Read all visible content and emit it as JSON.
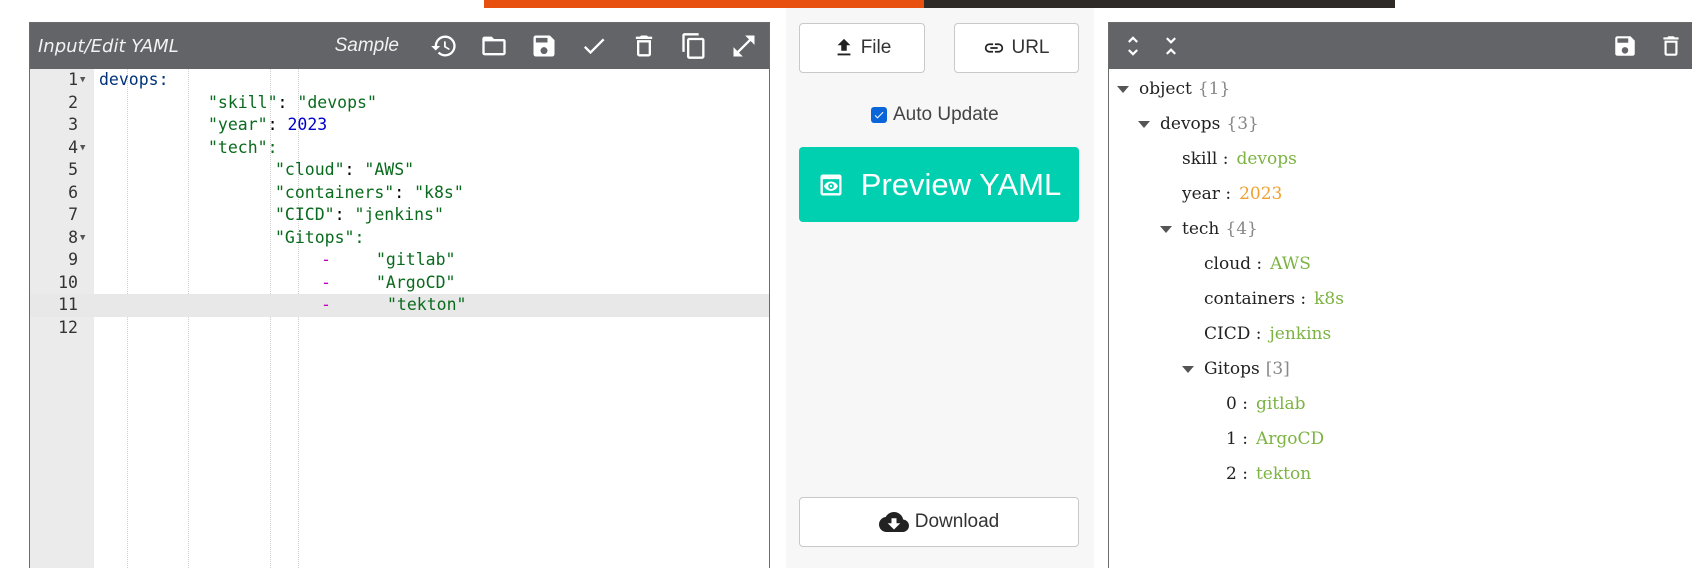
{
  "editor": {
    "title": "Input/Edit YAML",
    "sample_label": "Sample",
    "lines": [
      {
        "num": "1",
        "fold": true
      },
      {
        "num": "2",
        "fold": false
      },
      {
        "num": "3",
        "fold": false
      },
      {
        "num": "4",
        "fold": true
      },
      {
        "num": "5",
        "fold": false
      },
      {
        "num": "6",
        "fold": false
      },
      {
        "num": "7",
        "fold": false
      },
      {
        "num": "8",
        "fold": true
      },
      {
        "num": "9",
        "fold": false
      },
      {
        "num": "10",
        "fold": false
      },
      {
        "num": "11",
        "fold": false
      },
      {
        "num": "12",
        "fold": false
      }
    ],
    "code": {
      "l1_key": "devops:",
      "l2_key": "\"skill\"",
      "l2_val": "\"devops\"",
      "l3_key": "\"year\"",
      "l3_val": "2023",
      "l4_key": "\"tech\":",
      "l5_key": "\"cloud\"",
      "l5_val": "\"AWS\"",
      "l6_key": "\"containers\"",
      "l6_val": "\"k8s\"",
      "l7_key": "\"CICD\"",
      "l7_val": "\"jenkins\"",
      "l8_key": "\"Gitops\":",
      "l9_val": "\"gitlab\"",
      "l10_val": "\"ArgoCD\"",
      "l11_val": "\"tekton\"",
      "dash": "-",
      "colon": ": "
    }
  },
  "middle": {
    "file_label": "File",
    "url_label": "URL",
    "auto_update_label": "Auto Update",
    "auto_update_checked": true,
    "preview_label": "Preview YAML",
    "download_label": "Download"
  },
  "tree": {
    "root_key": "object",
    "root_count": "{1}",
    "devops_key": "devops",
    "devops_count": "{3}",
    "skill_key": "skill :",
    "skill_val": "devops",
    "year_key": "year :",
    "year_val": "2023",
    "tech_key": "tech",
    "tech_count": "{4}",
    "cloud_key": "cloud :",
    "cloud_val": "AWS",
    "containers_key": "containers :",
    "containers_val": "k8s",
    "cicd_key": "CICD :",
    "cicd_val": "jenkins",
    "gitops_key": "Gitops",
    "gitops_count": "[3]",
    "g0_key": "0 :",
    "g0_val": "gitlab",
    "g1_key": "1 :",
    "g1_val": "ArgoCD",
    "g2_key": "2 :",
    "g2_val": "tekton"
  },
  "colors": {
    "toolbar": "#626468",
    "preview_button": "#00cfb0",
    "tree_string": "#7cb342",
    "tree_number": "#f0a030",
    "banner_orange": "#e8500f"
  }
}
